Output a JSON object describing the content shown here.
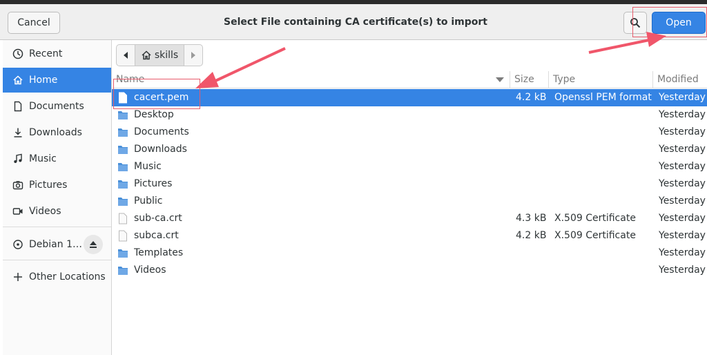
{
  "dialog": {
    "title": "Select File containing CA certificate(s) to import",
    "cancel_label": "Cancel",
    "open_label": "Open"
  },
  "sidebar": {
    "items": [
      {
        "label": "Recent",
        "icon": "clock-icon"
      },
      {
        "label": "Home",
        "icon": "home-icon"
      },
      {
        "label": "Documents",
        "icon": "document-icon"
      },
      {
        "label": "Downloads",
        "icon": "download-icon"
      },
      {
        "label": "Music",
        "icon": "music-icon"
      },
      {
        "label": "Pictures",
        "icon": "camera-icon"
      },
      {
        "label": "Videos",
        "icon": "video-icon"
      }
    ],
    "device": {
      "label": "Debian 1…",
      "icon": "disc-icon"
    },
    "other": {
      "label": "Other Locations",
      "icon": "plus-icon"
    }
  },
  "pathbar": {
    "crumb": "skills"
  },
  "columns": {
    "name": "Name",
    "size": "Size",
    "type": "Type",
    "modified": "Modified"
  },
  "files": [
    {
      "name": "cacert.pem",
      "size": "4.2 kB",
      "type": "Openssl PEM format",
      "modified": "Yesterday",
      "kind": "file"
    },
    {
      "name": "Desktop",
      "size": "",
      "type": "",
      "modified": "Yesterday",
      "kind": "folder"
    },
    {
      "name": "Documents",
      "size": "",
      "type": "",
      "modified": "Yesterday",
      "kind": "folder"
    },
    {
      "name": "Downloads",
      "size": "",
      "type": "",
      "modified": "Yesterday",
      "kind": "folder"
    },
    {
      "name": "Music",
      "size": "",
      "type": "",
      "modified": "Yesterday",
      "kind": "folder"
    },
    {
      "name": "Pictures",
      "size": "",
      "type": "",
      "modified": "Yesterday",
      "kind": "folder"
    },
    {
      "name": "Public",
      "size": "",
      "type": "",
      "modified": "Yesterday",
      "kind": "folder"
    },
    {
      "name": "sub-ca.crt",
      "size": "4.3 kB",
      "type": "X.509 Certificate",
      "modified": "Yesterday",
      "kind": "file"
    },
    {
      "name": "subca.crt",
      "size": "4.2 kB",
      "type": "X.509 Certificate",
      "modified": "Yesterday",
      "kind": "file"
    },
    {
      "name": "Templates",
      "size": "",
      "type": "",
      "modified": "Yesterday",
      "kind": "folder"
    },
    {
      "name": "Videos",
      "size": "",
      "type": "",
      "modified": "Yesterday",
      "kind": "folder"
    }
  ],
  "selected_file_index": 0,
  "colors": {
    "accent": "#3584e4",
    "annotation": "#e85b6a",
    "folder": "#4a90d9"
  }
}
